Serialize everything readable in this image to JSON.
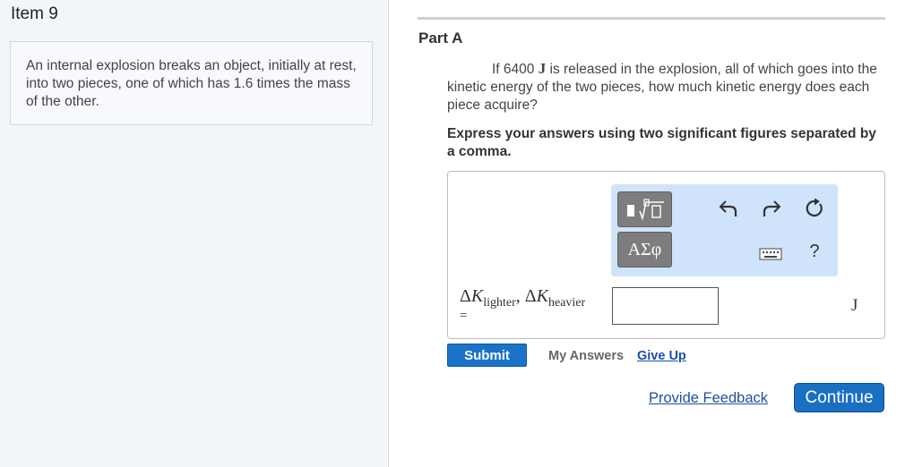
{
  "item": {
    "title": "Item 9"
  },
  "intro": {
    "text": "An internal explosion breaks an object, initially at rest, into two pieces, one of which has 1.6 times the mass of the other."
  },
  "part": {
    "title": "Part A",
    "question_prefix": "If 6400 ",
    "question_unit": "J",
    "question_suffix": " is released in the explosion, all of which goes into the kinetic energy of the two pieces, how much kinetic energy does each piece acquire?",
    "instruction": "Express your answers using two significant figures separated by a comma."
  },
  "toolbar": {
    "symbols_label": "ΑΣφ",
    "help_label": "?",
    "icons": [
      "templates-icon",
      "undo-icon",
      "redo-icon",
      "reset-icon",
      "keyboard-icon",
      "help-icon"
    ]
  },
  "answer": {
    "delta1": "Δ",
    "var1": "K",
    "sub1": "lighter",
    "comma": ", ",
    "delta2": "Δ",
    "var2": "K",
    "sub2": "heavier",
    "equals": "=",
    "value": "",
    "unit": "J"
  },
  "actions": {
    "submit_label": "Submit",
    "my_answers_label": "My Answers",
    "give_up_label": "Give Up",
    "feedback_label": "Provide Feedback",
    "continue_label": "Continue"
  },
  "colors": {
    "primary_button": "#1a73c8",
    "toolbar_bg": "#cfe3fb",
    "left_panel_bg": "#f2f6fb",
    "link": "#1b4ea8"
  }
}
